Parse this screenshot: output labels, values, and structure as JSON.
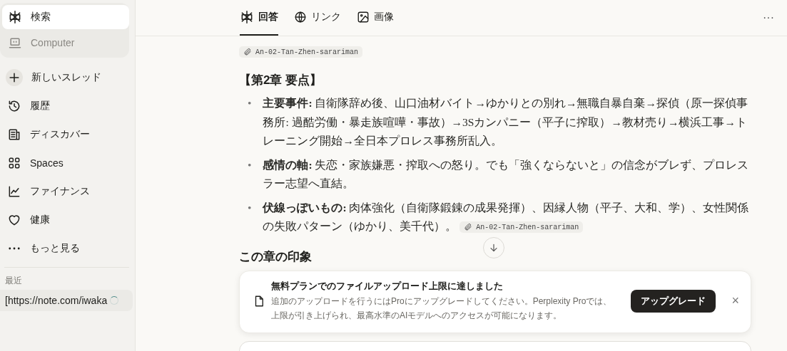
{
  "sidebar": {
    "modes": [
      {
        "label": "検索",
        "selected": true
      },
      {
        "label": "Computer",
        "selected": false
      }
    ],
    "items": [
      {
        "label": "新しいスレッド"
      },
      {
        "label": "履歴"
      },
      {
        "label": "ディスカバー"
      },
      {
        "label": "Spaces"
      },
      {
        "label": "ファイナンス"
      },
      {
        "label": "健康"
      },
      {
        "label": "もっと見る"
      }
    ],
    "recent": {
      "heading": "最近",
      "items": [
        {
          "label": "[https://note.com/iwaka",
          "loading": true
        }
      ]
    }
  },
  "tabs": [
    {
      "label": "回答",
      "selected": true
    },
    {
      "label": "リンク",
      "selected": false
    },
    {
      "label": "画像",
      "selected": false
    }
  ],
  "answer": {
    "attachment": "An-02-Tan-Zhen-sarariman",
    "heading": "【第2章 要点】",
    "bullets": [
      {
        "marker": "•",
        "text": "**主要事件:** 自衛隊辞め後、山口油材バイト→ゆかりとの別れ→無職自暴自棄→探偵（原一探偵事務所: 過酷労働・暴走族喧嘩・事故）→3Sカンパニー（平子に搾取）→教材売り→横浜工事→トレーニング開始→全日本プロレス事務所乱入。"
      },
      {
        "marker": "•",
        "text": "**感情の軸:** 失恋・家族嫌悪・搾取への怒り。でも「強くならないと」の信念がブレず、プロレスラー志望へ直結。"
      },
      {
        "marker": "•",
        "text": "**伏線っぽいもの:** 肉体強化（自衛隊鍛錬の成果発揮）、因縁人物（平子、大和、学）、女性関係の失敗パターン（ゆかり、美千代）。",
        "attachment": "An-02-Tan-Zhen-sarariman"
      }
    ],
    "heading_2": "この章の印象"
  },
  "notice": {
    "title": "無料プランでのファイルアップロード上限に達しました",
    "body": "追加のアップロードを行うにはProにアップグレードしてください。Perplexity Proでは、上限が引き上げられ、最高水準のAIモデルへのアクセスが可能になります。",
    "button": "アップグレード",
    "close": "×"
  },
  "header_menu": "···"
}
